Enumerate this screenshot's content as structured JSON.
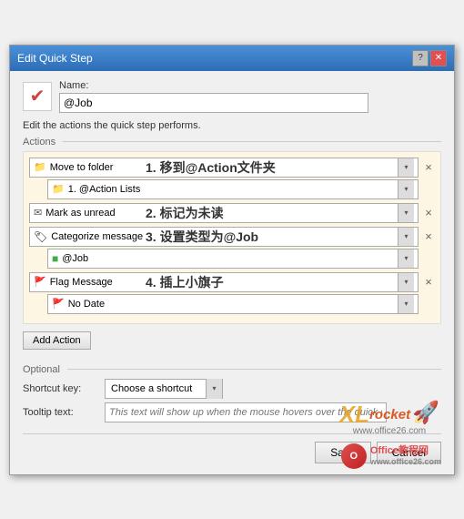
{
  "dialog": {
    "title": "Edit Quick Step",
    "help_btn": "?",
    "close_btn": "✕"
  },
  "name_section": {
    "label": "Name:",
    "value": "@Job",
    "icon": "✔"
  },
  "edit_desc": "Edit the actions the quick step performs.",
  "sections": {
    "actions_label": "Actions",
    "optional_label": "Optional"
  },
  "actions": [
    {
      "id": "move-to-folder",
      "label": "Move to folder",
      "icon": "📁",
      "annotation": "1. 移到@Action文件夹",
      "sub": {
        "label": "1. @Action Lists",
        "icon": "📁"
      }
    },
    {
      "id": "mark-as-unread",
      "label": "Mark as unread",
      "icon": "✉",
      "annotation": "2. 标记为未读",
      "sub": null
    },
    {
      "id": "categorize-message",
      "label": "Categorize message",
      "icon": "🏷",
      "annotation": "3. 设置类型为@Job",
      "sub": {
        "label": "@Job",
        "icon": "🟩"
      }
    },
    {
      "id": "flag-message",
      "label": "Flag Message",
      "icon": "🚩",
      "annotation": "4. 插上小旗子",
      "sub": {
        "label": "No Date",
        "icon": "🚩"
      }
    }
  ],
  "add_action_btn": "Add Action",
  "optional": {
    "shortcut_label": "Shortcut key:",
    "shortcut_value": "Choose a shortcut",
    "tooltip_label": "Tooltip text:",
    "tooltip_placeholder": "This text will show up when the mouse hovers over the quick step."
  },
  "footer": {
    "save_btn": "Save",
    "cancel_btn": "Cancel"
  },
  "watermark": {
    "xl": "XL",
    "rocket_text": "rocket",
    "site": "www.office26.com"
  }
}
